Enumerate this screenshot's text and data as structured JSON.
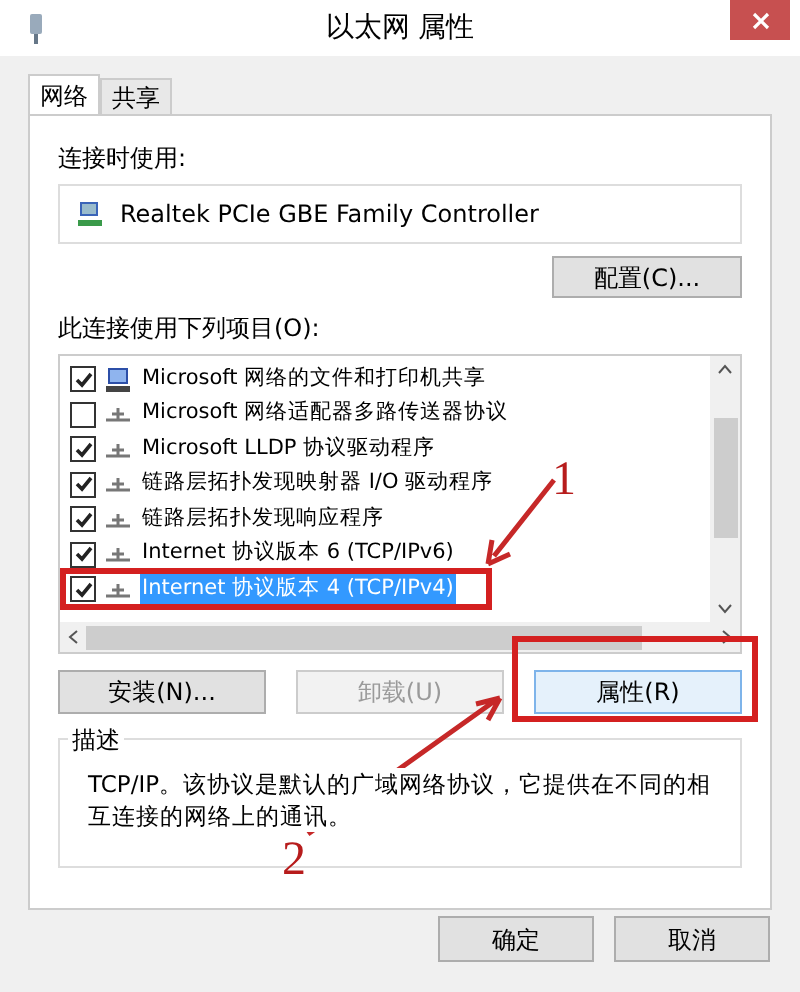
{
  "window": {
    "title": "以太网 属性"
  },
  "tabs": [
    {
      "label": "网络",
      "selected": true
    },
    {
      "label": "共享",
      "selected": false
    }
  ],
  "connect_using": {
    "label": "连接时使用:",
    "adapter": "Realtek PCIe GBE Family Controller",
    "configure_button": "配置(C)..."
  },
  "items_label": "此连接使用下列项目(O):",
  "items": [
    {
      "label": "Microsoft 网络的文件和打印机共享",
      "checked": true,
      "selected": false,
      "kind": "computer"
    },
    {
      "label": "Microsoft 网络适配器多路传送器协议",
      "checked": false,
      "selected": false,
      "kind": "protocol"
    },
    {
      "label": "Microsoft LLDP 协议驱动程序",
      "checked": true,
      "selected": false,
      "kind": "protocol"
    },
    {
      "label": "链路层拓扑发现映射器 I/O 驱动程序",
      "checked": true,
      "selected": false,
      "kind": "protocol"
    },
    {
      "label": "链路层拓扑发现响应程序",
      "checked": true,
      "selected": false,
      "kind": "protocol"
    },
    {
      "label": "Internet 协议版本 6 (TCP/IPv6)",
      "checked": true,
      "selected": false,
      "kind": "protocol"
    },
    {
      "label": "Internet 协议版本 4 (TCP/IPv4)",
      "checked": true,
      "selected": true,
      "kind": "protocol"
    }
  ],
  "buttons": [
    {
      "label": "安装(N)...",
      "disabled": false
    },
    {
      "label": "卸载(U)",
      "disabled": true
    },
    {
      "label": "属性(R)",
      "disabled": false
    }
  ],
  "description": {
    "legend": "描述",
    "text": "TCP/IP。该协议是默认的广域网络协议，它提供在不同的相互连接的网络上的通讯。"
  },
  "annotations": [
    {
      "label": "1"
    },
    {
      "label": "2"
    }
  ],
  "footer_buttons": [
    "确定",
    "取消"
  ]
}
